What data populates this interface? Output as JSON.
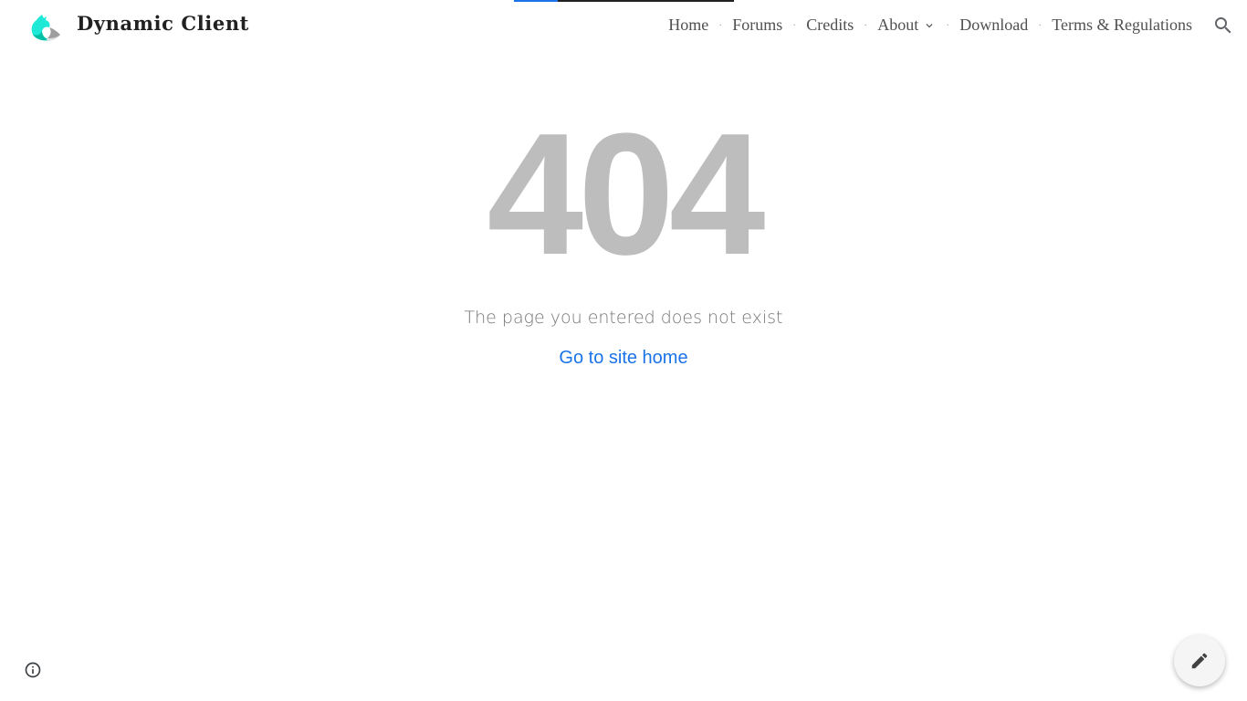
{
  "loading": {
    "progress": 0.2
  },
  "header": {
    "site_title": "Dynamic Client",
    "logo_icon": "bird-logo-icon",
    "nav": [
      {
        "label": "Home"
      },
      {
        "label": "Forums"
      },
      {
        "label": "Credits"
      },
      {
        "label": "About",
        "has_dropdown": true
      },
      {
        "label": "Download"
      },
      {
        "label": "Terms & Regulations"
      }
    ],
    "separator": "·",
    "search_icon": "search-icon"
  },
  "main": {
    "error_code": "404",
    "message": "The page you entered does not exist",
    "home_link": "Go to site home"
  },
  "footer": {
    "info_icon": "info-icon",
    "edit_icon": "pencil-icon"
  },
  "colors": {
    "accent": "#1a73e8",
    "error_code": "#bdbdbd",
    "message": "#757575",
    "logo_primary": "#1de9d6"
  }
}
